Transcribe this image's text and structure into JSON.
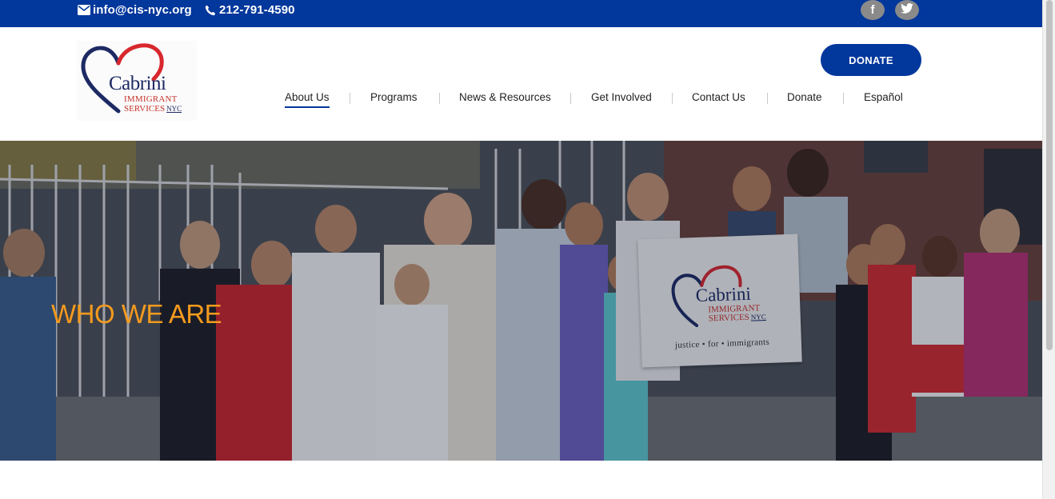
{
  "topbar": {
    "email": "info@cis-nyc.org",
    "phone": "212-791-4590",
    "social": [
      {
        "icon": "facebook-icon",
        "glyph": "f"
      },
      {
        "icon": "twitter-icon"
      }
    ]
  },
  "logo": {
    "word": "Cabrini",
    "line1": "IMMIGRANT",
    "line2": "SERVICES",
    "nyc": "NYC"
  },
  "header": {
    "donate_label": "DONATE"
  },
  "nav": {
    "items": [
      {
        "label": "About Us",
        "active": true
      },
      {
        "label": "Programs"
      },
      {
        "label": "News & Resources"
      },
      {
        "label": "Get Involved"
      },
      {
        "label": "Contact Us"
      },
      {
        "label": "Donate"
      },
      {
        "label": "Español"
      }
    ]
  },
  "hero": {
    "title": "WHO WE ARE",
    "banner": {
      "word": "Cabrini",
      "line1": "IMMIGRANT",
      "line2": "SERVICES",
      "nyc": "NYC",
      "tagline": "justice • for • immigrants"
    }
  },
  "colors": {
    "brand_blue": "#02379c",
    "hero_title": "#f39a1e",
    "logo_red": "#c8322b",
    "logo_navy": "#1d2a63"
  }
}
